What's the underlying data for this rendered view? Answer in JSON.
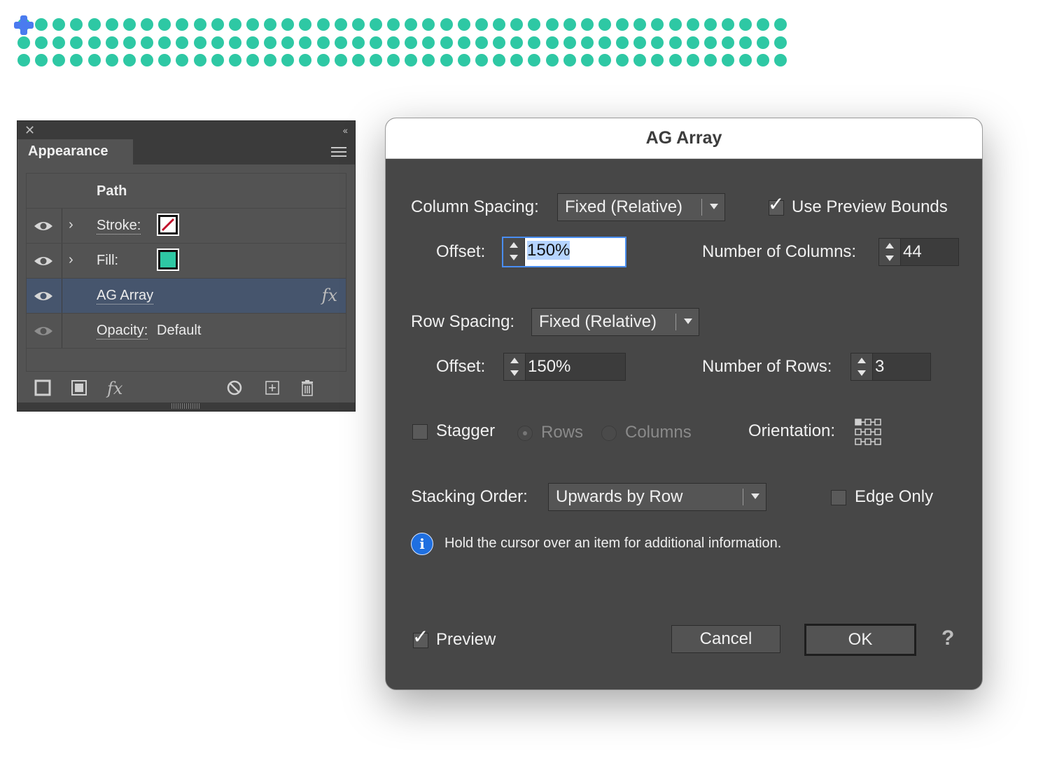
{
  "canvas": {
    "dot_color": "#2ec8a4",
    "origin_color": "#4a7bef",
    "columns": 44,
    "rows": 3
  },
  "appearance_panel": {
    "tab_label": "Appearance",
    "close_glyph": "✕",
    "collapse_glyph": "‹‹",
    "rows": {
      "path_label": "Path",
      "stroke_label": "Stroke:",
      "fill_label": "Fill:",
      "effect_label": "AG Array",
      "effect_badge": "fx",
      "opacity_label": "Opacity:",
      "opacity_value": "Default",
      "chevron": "›"
    },
    "stroke_color": "#c0102a",
    "fill_color": "#2ec8a4",
    "footer_icons": [
      "new-stroke-icon",
      "new-fill-icon",
      "fx-icon",
      "clear-icon",
      "duplicate-icon",
      "trash-icon"
    ],
    "fx_footer_label": "fx",
    "selected_row_color": "#46556d"
  },
  "dialog": {
    "title": "AG Array",
    "column_spacing_label": "Column Spacing:",
    "column_spacing_value": "Fixed (Relative)",
    "use_preview_bounds_label": "Use Preview Bounds",
    "use_preview_bounds_checked": true,
    "column_offset_label": "Offset:",
    "column_offset_value": "150%",
    "num_columns_label": "Number of Columns:",
    "num_columns_value": "44",
    "row_spacing_label": "Row Spacing:",
    "row_spacing_value": "Fixed (Relative)",
    "row_offset_label": "Offset:",
    "row_offset_value": "150%",
    "num_rows_label": "Number of Rows:",
    "num_rows_value": "3",
    "stagger_label": "Stagger",
    "stagger_checked": false,
    "stagger_rows_label": "Rows",
    "stagger_columns_label": "Columns",
    "orientation_label": "Orientation:",
    "stacking_order_label": "Stacking Order:",
    "stacking_order_value": "Upwards by Row",
    "edge_only_label": "Edge Only",
    "edge_only_checked": false,
    "info_glyph": "i",
    "info_text": "Hold the cursor over an item for additional information.",
    "preview_label": "Preview",
    "preview_checked": true,
    "cancel_label": "Cancel",
    "ok_label": "OK",
    "help_glyph": "?",
    "checkmark_glyph": "✓"
  }
}
